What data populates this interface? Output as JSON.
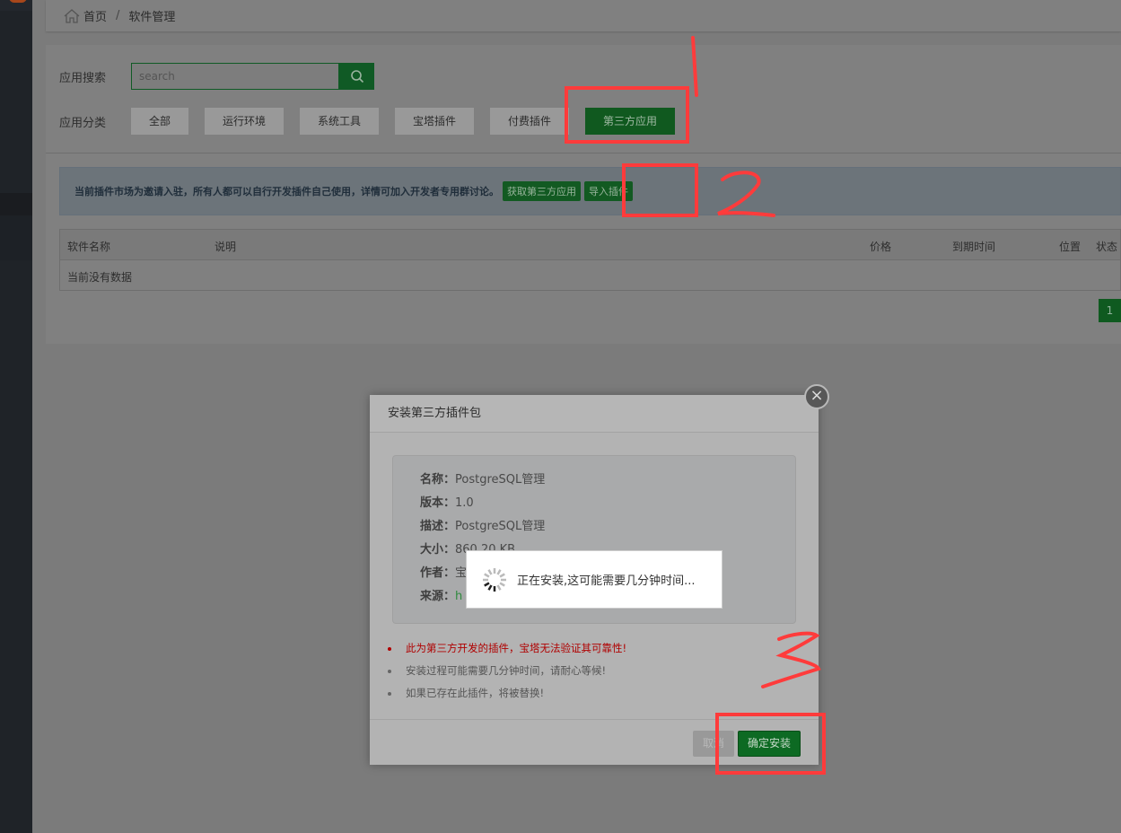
{
  "breadcrumb": {
    "home": "首页",
    "separator": "/",
    "current": "软件管理"
  },
  "search": {
    "label": "应用搜索",
    "placeholder": "search"
  },
  "category": {
    "label": "应用分类",
    "items": [
      "全部",
      "运行环境",
      "系统工具",
      "宝塔插件",
      "付费插件",
      "第三方应用"
    ],
    "active": "第三方应用"
  },
  "notice": {
    "text": "当前插件市场为邀请入驻，所有人都可以自行开发插件自己使用，详情可加入开发者专用群讨论。",
    "get_third_party": "获取第三方应用",
    "import_plugin": "导入插件"
  },
  "table": {
    "columns": [
      "软件名称",
      "说明",
      "价格",
      "到期时间",
      "位置",
      "状态"
    ],
    "empty": "当前没有数据"
  },
  "pagination": {
    "current": "1"
  },
  "modal": {
    "title": "安装第三方插件包",
    "fields": [
      {
        "label": "名称：",
        "value": "PostgreSQL管理"
      },
      {
        "label": "版本：",
        "value": "1.0"
      },
      {
        "label": "描述：",
        "value": "PostgreSQL管理"
      },
      {
        "label": "大小：",
        "value": "860.20 KB"
      },
      {
        "label": "作者：",
        "value": "宝"
      },
      {
        "label": "来源：",
        "value": "h"
      }
    ],
    "tips": [
      "此为第三方开发的插件，宝塔无法验证其可靠性!",
      "安装过程可能需要几分钟时间，请耐心等候!",
      "如果已存在此插件，将被替换!"
    ],
    "cancel": "取消",
    "confirm": "确定安装",
    "close": "×"
  },
  "loading": {
    "text": "正在安装,这可能需要几分钟时间..."
  },
  "colors": {
    "accent": "#20a53a",
    "annotation": "#ff3b3b",
    "warning": "#b00000"
  }
}
